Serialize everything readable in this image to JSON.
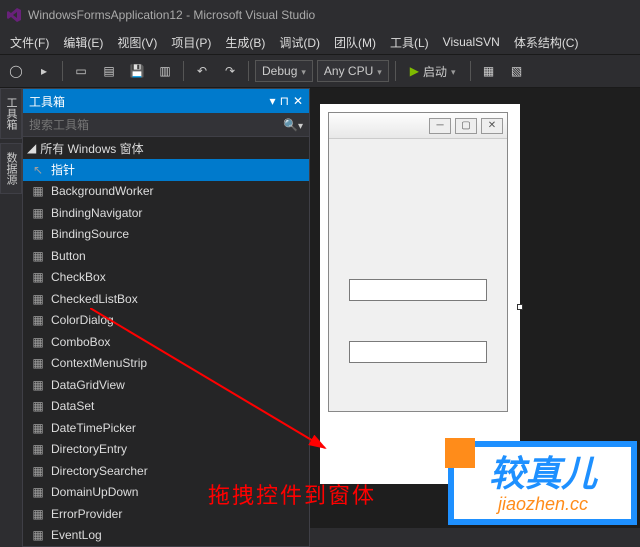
{
  "title": "WindowsFormsApplication12 - Microsoft Visual Studio",
  "menu": {
    "file": "文件(F)",
    "edit": "编辑(E)",
    "view": "视图(V)",
    "project": "项目(P)",
    "build": "生成(B)",
    "debug": "调试(D)",
    "team": "团队(M)",
    "tools": "工具(L)",
    "visualsvn": "VisualSVN",
    "arch": "体系结构(C)"
  },
  "toolbar": {
    "config": "Debug",
    "platform": "Any CPU",
    "start": "启动"
  },
  "sidetab": {
    "toolbox": "工具箱",
    "datasource": "数据源"
  },
  "toolbox": {
    "title": "工具箱",
    "search_placeholder": "搜索工具箱",
    "category": "所有 Windows 窗体",
    "items": [
      "指针",
      "BackgroundWorker",
      "BindingNavigator",
      "BindingSource",
      "Button",
      "CheckBox",
      "CheckedListBox",
      "ColorDialog",
      "ComboBox",
      "ContextMenuStrip",
      "DataGridView",
      "DataSet",
      "DateTimePicker",
      "DirectoryEntry",
      "DirectorySearcher",
      "DomainUpDown",
      "ErrorProvider",
      "EventLog"
    ],
    "selected_index": 0
  },
  "annotation": "拖拽控件到窗体",
  "watermark": {
    "main": "较真儿",
    "sub": "jiaozhen.cc"
  }
}
